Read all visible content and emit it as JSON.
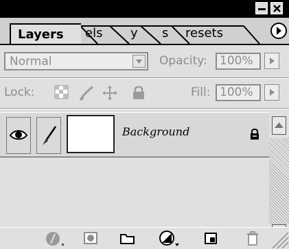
{
  "window": {
    "controls": [
      "minimize-icon",
      "close-icon"
    ]
  },
  "tabs": [
    {
      "label": "Layers",
      "active": true
    },
    {
      "label": "els",
      "active": false
    },
    {
      "label": "y",
      "active": false
    },
    {
      "label": "s",
      "active": false
    },
    {
      "label": "resets",
      "active": false
    }
  ],
  "blend": {
    "mode": "Normal",
    "opacity_label": "Opacity:",
    "opacity_value": "100%"
  },
  "lock": {
    "label": "Lock:",
    "fill_label": "Fill:",
    "fill_value": "100%"
  },
  "layers": [
    {
      "name": "Background",
      "visible": true,
      "locked": true
    }
  ],
  "bottom_icons": [
    "layer-style-icon",
    "mask-icon",
    "new-group-icon",
    "adjustment-layer-icon",
    "new-layer-icon",
    "trash-icon"
  ]
}
